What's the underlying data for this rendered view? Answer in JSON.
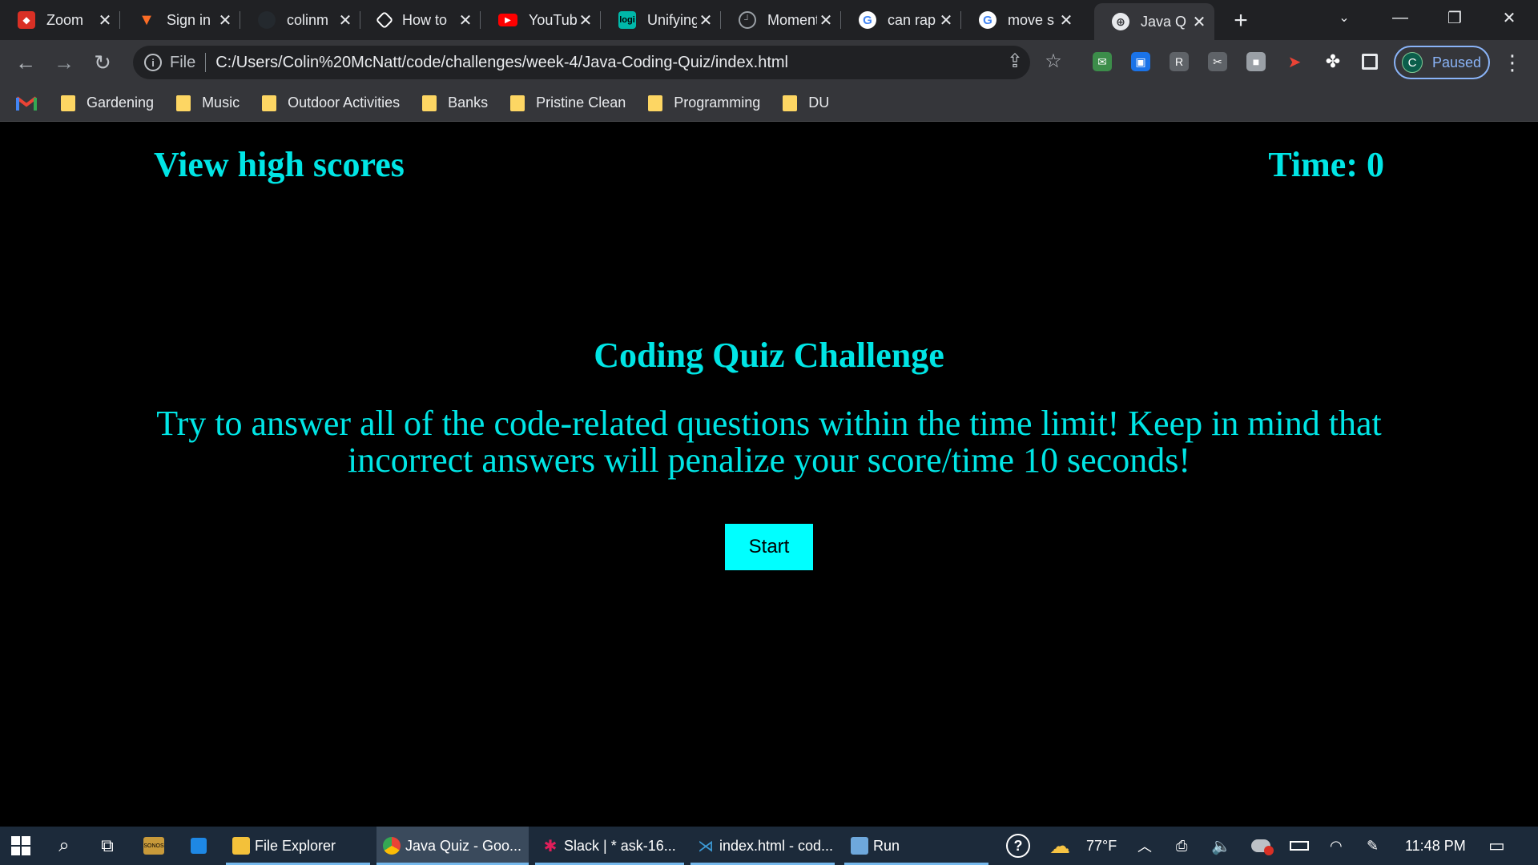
{
  "browser": {
    "tabs": [
      {
        "title": "Zoom",
        "icon": "zoom-shield-icon",
        "color": "#d93025"
      },
      {
        "title": "Sign in",
        "icon": "gitlab-icon",
        "color": "#fc6d26"
      },
      {
        "title": "colinm",
        "icon": "github-icon",
        "color": "#24292e"
      },
      {
        "title": "How to",
        "icon": "diamond-icon",
        "color": "#ffffff"
      },
      {
        "title": "YouTube",
        "icon": "youtube-icon",
        "color": "#ff0000"
      },
      {
        "title": "Unifying",
        "icon": "logi-icon",
        "color": "#00b8a9"
      },
      {
        "title": "Moment",
        "icon": "clock-icon",
        "color": "#9aa0a6"
      },
      {
        "title": "can rap",
        "icon": "google-icon",
        "color": "#4285f4"
      },
      {
        "title": "move s",
        "icon": "google-icon",
        "color": "#4285f4"
      },
      {
        "title": "Java Q",
        "icon": "globe-icon",
        "color": "#e8eaed"
      }
    ],
    "active_tab_index": 9,
    "address": {
      "scheme": "File",
      "url": "C:/Users/Colin%20McNatt/code/challenges/week-4/Java-Coding-Quiz/index.html"
    },
    "profile": {
      "initial": "C",
      "status": "Paused"
    },
    "bookmarks": [
      "Gardening",
      "Music",
      "Outdoor Activities",
      "Banks",
      "Pristine Clean",
      "Programming",
      "DU"
    ]
  },
  "page": {
    "highscores_link": "View high scores",
    "timer_label": "Time: 0",
    "title": "Coding Quiz Challenge",
    "description": "Try to answer all of the code-related questions within the time limit! Keep in mind that incorrect answers will penalize your score/time 10 seconds!",
    "start_button": "Start",
    "accent_color": "#00ffff"
  },
  "taskbar": {
    "apps": [
      {
        "label": "File Explorer",
        "icon": "folder-icon"
      },
      {
        "label": "Java Quiz - Goo...",
        "icon": "chrome-icon",
        "active": true
      },
      {
        "label": "Slack | * ask-16...",
        "icon": "slack-icon"
      },
      {
        "label": "index.html - cod...",
        "icon": "vscode-icon"
      },
      {
        "label": "Run",
        "icon": "run-icon"
      }
    ],
    "temperature": "77°F",
    "clock": "11:48 PM"
  }
}
